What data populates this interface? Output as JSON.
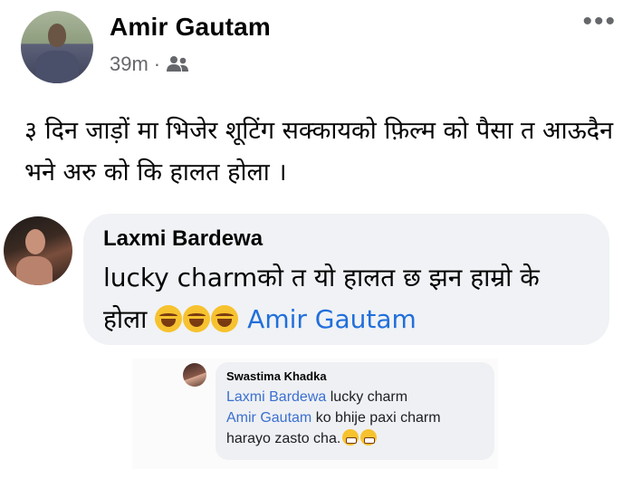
{
  "post": {
    "author": "Amir Gautam",
    "time": "39m",
    "separator": "·",
    "audience_icon": "friends-icon",
    "more_icon": "more-options-icon",
    "text": "३ दिन जाड़ों मा भिजेर शूटिंग सक्कायको फ़िल्म को पैसा त आऊदैन भने अरु को कि हालत होला ।"
  },
  "comment": {
    "author": "Laxmi Bardewa",
    "text": "lucky charmको त यो हालत छ झन हाम्रो के होला",
    "emojis": [
      "rolling-laughing-emoji",
      "rolling-laughing-emoji",
      "rolling-laughing-emoji"
    ],
    "mention": "Amir Gautam"
  },
  "reply": {
    "author": "Swastima Khadka",
    "mention1": "Laxmi Bardewa",
    "text1": "lucky charm",
    "mention2": "Amir Gautam",
    "text2": "ko bhije paxi charm harayo zasto cha.",
    "emojis": [
      "grimacing-emoji",
      "grimacing-emoji"
    ]
  },
  "colors": {
    "mention": "#216fdb",
    "bubble": "#f0f2f5",
    "meta": "#65676b"
  }
}
